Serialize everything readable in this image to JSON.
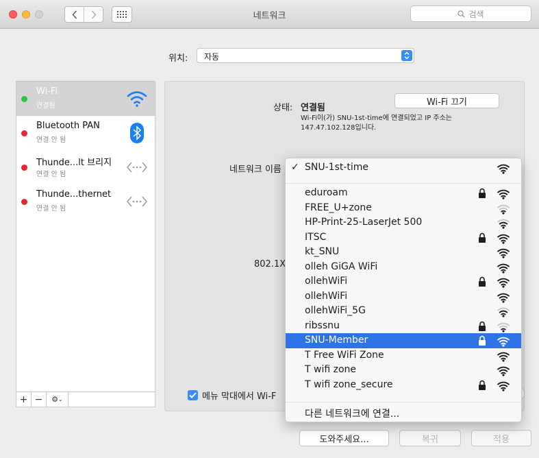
{
  "window": {
    "title": "네트워크",
    "search_placeholder": "검색"
  },
  "location": {
    "label": "위치:",
    "value": "자동"
  },
  "services": [
    {
      "name": "Wi-Fi",
      "status": "연결됨",
      "dot": "green",
      "icon": "wifi-icon",
      "selected": true
    },
    {
      "name": "Bluetooth PAN",
      "status": "연결 안 됨",
      "dot": "red",
      "icon": "bluetooth-icon",
      "selected": false
    },
    {
      "name": "Thunde...lt 브리지",
      "status": "연결 안 됨",
      "dot": "red",
      "icon": "thunderbolt-bridge-icon",
      "selected": false
    },
    {
      "name": "Thunde...thernet",
      "status": "연결 안 됨",
      "dot": "red",
      "icon": "thunderbolt-ethernet-icon",
      "selected": false
    }
  ],
  "toolbar": {
    "add": "+",
    "remove": "−"
  },
  "detail": {
    "status_label": "상태:",
    "status_value": "연결됨",
    "wifi_off_button": "Wi-Fi 끄기",
    "status_line1": "Wi-Fi이(가) SNU-1st-time에 연결되었고 IP 주소는",
    "status_line2": "147.47.102.128입니다.",
    "network_name_label": "네트워크 이름",
    "label_8021x": "802.1X",
    "menubar_check_label": "메뉴 막대에서 Wi-F",
    "menubar_checked": true
  },
  "buttons": {
    "help": "도와주세요...",
    "revert": "복귀",
    "apply": "적용"
  },
  "menu": {
    "current": {
      "name": "SNU-1st-time",
      "signal": 3
    },
    "networks": [
      {
        "name": "eduroam",
        "locked": true,
        "signal": 3
      },
      {
        "name": "FREE_U+zone",
        "locked": false,
        "signal": 1
      },
      {
        "name": "HP-Print-25-LaserJet 500",
        "locked": false,
        "signal": 2
      },
      {
        "name": "ITSC",
        "locked": true,
        "signal": 3
      },
      {
        "name": "kt_SNU",
        "locked": false,
        "signal": 3
      },
      {
        "name": "olleh GiGA WiFi",
        "locked": false,
        "signal": 3
      },
      {
        "name": "ollehWiFi",
        "locked": true,
        "signal": 3
      },
      {
        "name": "ollehWiFi",
        "locked": false,
        "signal": 3
      },
      {
        "name": "ollehWiFi_5G",
        "locked": false,
        "signal": 2
      },
      {
        "name": "ribssnu",
        "locked": true,
        "signal": 1
      },
      {
        "name": "SNU-Member",
        "locked": true,
        "signal": 3,
        "highlighted": true
      },
      {
        "name": "T Free WiFi Zone",
        "locked": false,
        "signal": 3
      },
      {
        "name": "T wifi zone",
        "locked": false,
        "signal": 3
      },
      {
        "name": "T wifi zone_secure",
        "locked": true,
        "signal": 3
      }
    ],
    "other_network": "다른 네트워크에 연결..."
  },
  "colors": {
    "accent": "#2e73e6",
    "connected": "#2ac53f",
    "disconnected": "#e8272c"
  }
}
